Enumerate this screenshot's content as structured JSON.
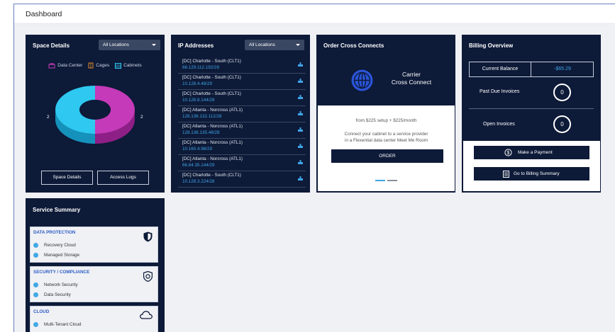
{
  "header": {
    "title": "Dashboard"
  },
  "space_details": {
    "title": "Space Details",
    "location_select": "All Locations",
    "legend": [
      "Data Center",
      "Cages",
      "Cabinets"
    ],
    "left_value": "2",
    "right_value": "2",
    "buttons": {
      "details": "Space Details",
      "access_logs": "Access Logs"
    },
    "colors": {
      "data_center": "#c53ab8",
      "cages": "#e08a2a",
      "cabinets": "#2ec8f0"
    }
  },
  "ip_addresses": {
    "title": "IP Addresses",
    "location_select": "All Locations",
    "rows": [
      {
        "name": "[DC] Charlotte - South (CLT1)",
        "ip": "66.129.112.192/29"
      },
      {
        "name": "[DC] Charlotte - South (CLT1)",
        "ip": "10.128.4.48/29"
      },
      {
        "name": "[DC] Charlotte - South (CLT1)",
        "ip": "10.128.8.144/28"
      },
      {
        "name": "[DC] Atlanta - Norcross (ATL1)",
        "ip": "128.136.132.112/28"
      },
      {
        "name": "[DC] Atlanta - Norcross (ATL1)",
        "ip": "128.136.135.48/28"
      },
      {
        "name": "[DC] Atlanta - Norcross (ATL1)",
        "ip": "10.160.4.96/29"
      },
      {
        "name": "[DC] Atlanta - Norcross (ATL1)",
        "ip": "66.64.35.144/29"
      },
      {
        "name": "[DC] Charlotte - South (CLT1)",
        "ip": "10.128.3.224/28"
      }
    ]
  },
  "cross_connects": {
    "title": "Order Cross Connects",
    "product_line1": "Carrier",
    "product_line2": "Cross Connect",
    "price": "from $225 setup + $225/month",
    "desc_line1": "Connect your cabinet to a service provider",
    "desc_line2": "in a Flexential data center Meet Me Room",
    "order_label": "ORDER"
  },
  "billing": {
    "title": "Billing Overview",
    "balance_label": "Current Balance",
    "balance_value": "-$65.29",
    "past_due_label": "Past Due Invoices",
    "past_due_value": "0",
    "open_label": "Open Invoices",
    "open_value": "0",
    "pay_label": "Make a Payment",
    "summary_label": "Go to Billing Summary"
  },
  "service_summary": {
    "title": "Service Summary",
    "groups": [
      {
        "heading": "DATA PROTECTION",
        "items": [
          "Recovery Cloud",
          "Managed Storage"
        ],
        "icon": "shield-icon"
      },
      {
        "heading": "SECURITY / COMPLIANCE",
        "items": [
          "Network Security",
          "Data Security"
        ],
        "icon": "security-lock-icon"
      },
      {
        "heading": "CLOUD",
        "items": [
          "Multi-Tenant Cloud"
        ],
        "icon": "cloud-icon"
      }
    ]
  }
}
